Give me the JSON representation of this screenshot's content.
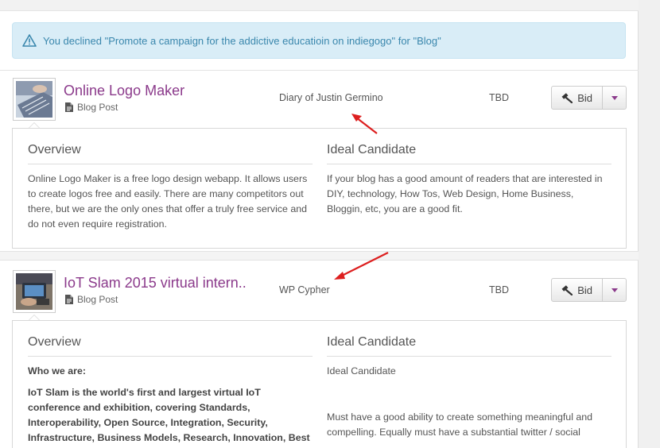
{
  "alert": {
    "text": "You declined \"Promote a campaign for the addictive educatioin on indiegogo\" for \"Blog\""
  },
  "listings": [
    {
      "title": "Online Logo Maker",
      "type": "Blog Post",
      "blog": "Diary of Justin Germino",
      "status": "TBD",
      "bid_label": "Bid",
      "overview_heading": "Overview",
      "candidate_heading": "Ideal Candidate",
      "overview_text": "Online Logo Maker is a free logo design webapp. It allows users to create logos free and easily. There are many competitors out there, but we are the only ones that offer a truly free service and do not even require registration.",
      "candidate_text": "If your blog has a good amount of readers that are interested in DIY, technology, How Tos, Web Design, Home Business, Bloggin, etc, you are a good fit."
    },
    {
      "title": "IoT Slam 2015 virtual intern..",
      "type": "Blog Post",
      "blog": "WP Cypher",
      "status": "TBD",
      "bid_label": "Bid",
      "overview_heading": "Overview",
      "candidate_heading": "Ideal Candidate",
      "overview_who": "Who we are:",
      "overview_text": "IoT Slam is the world's first and largest virtual IoT conference and exhibition, covering Standards, Interoperability, Open Source, Integration, Security, Infrastructure, Business Models, Research, Innovation, Best Practices, Technology,",
      "candidate_sub": "Ideal Candidate",
      "candidate_text": "Must have a good ability to create something meaningful and compelling. Equally must have a substantial twitter / social"
    }
  ],
  "colors": {
    "title": "#8b3a8b",
    "alert_bg": "#d9edf7",
    "alert_text": "#3a87ad",
    "annotation_arrow": "#dd1f1f"
  }
}
